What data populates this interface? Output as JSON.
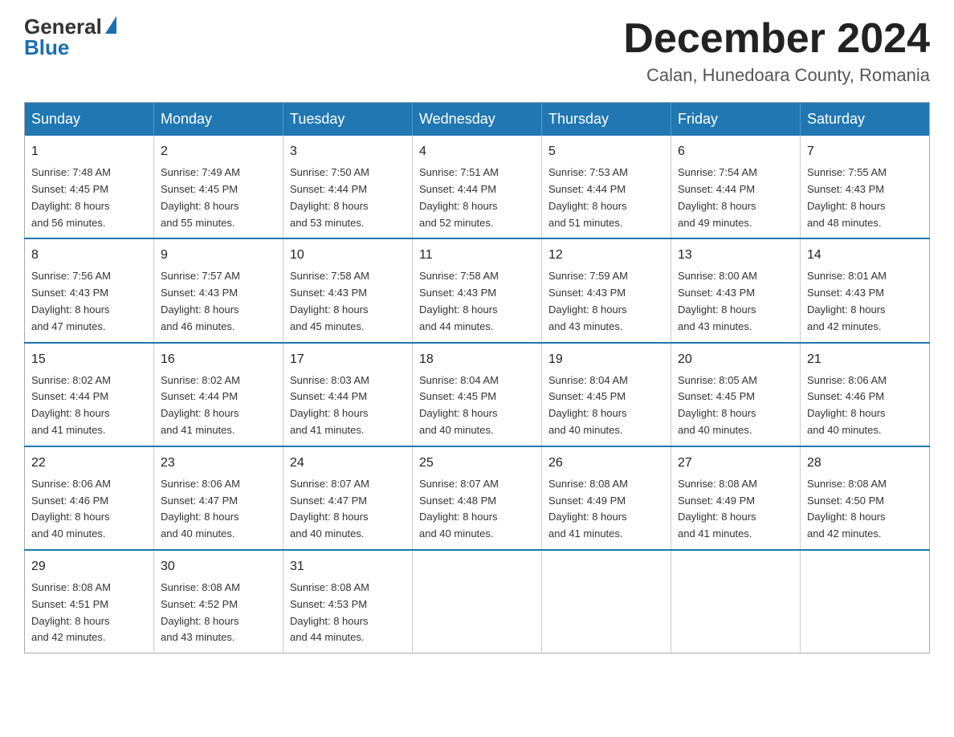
{
  "header": {
    "logo_line1": "General",
    "logo_line2": "Blue",
    "month_title": "December 2024",
    "location": "Calan, Hunedoara County, Romania"
  },
  "weekdays": [
    "Sunday",
    "Monday",
    "Tuesday",
    "Wednesday",
    "Thursday",
    "Friday",
    "Saturday"
  ],
  "weeks": [
    [
      {
        "day": "1",
        "sunrise": "7:48 AM",
        "sunset": "4:45 PM",
        "daylight": "8 hours and 56 minutes."
      },
      {
        "day": "2",
        "sunrise": "7:49 AM",
        "sunset": "4:45 PM",
        "daylight": "8 hours and 55 minutes."
      },
      {
        "day": "3",
        "sunrise": "7:50 AM",
        "sunset": "4:44 PM",
        "daylight": "8 hours and 53 minutes."
      },
      {
        "day": "4",
        "sunrise": "7:51 AM",
        "sunset": "4:44 PM",
        "daylight": "8 hours and 52 minutes."
      },
      {
        "day": "5",
        "sunrise": "7:53 AM",
        "sunset": "4:44 PM",
        "daylight": "8 hours and 51 minutes."
      },
      {
        "day": "6",
        "sunrise": "7:54 AM",
        "sunset": "4:44 PM",
        "daylight": "8 hours and 49 minutes."
      },
      {
        "day": "7",
        "sunrise": "7:55 AM",
        "sunset": "4:43 PM",
        "daylight": "8 hours and 48 minutes."
      }
    ],
    [
      {
        "day": "8",
        "sunrise": "7:56 AM",
        "sunset": "4:43 PM",
        "daylight": "8 hours and 47 minutes."
      },
      {
        "day": "9",
        "sunrise": "7:57 AM",
        "sunset": "4:43 PM",
        "daylight": "8 hours and 46 minutes."
      },
      {
        "day": "10",
        "sunrise": "7:58 AM",
        "sunset": "4:43 PM",
        "daylight": "8 hours and 45 minutes."
      },
      {
        "day": "11",
        "sunrise": "7:58 AM",
        "sunset": "4:43 PM",
        "daylight": "8 hours and 44 minutes."
      },
      {
        "day": "12",
        "sunrise": "7:59 AM",
        "sunset": "4:43 PM",
        "daylight": "8 hours and 43 minutes."
      },
      {
        "day": "13",
        "sunrise": "8:00 AM",
        "sunset": "4:43 PM",
        "daylight": "8 hours and 43 minutes."
      },
      {
        "day": "14",
        "sunrise": "8:01 AM",
        "sunset": "4:43 PM",
        "daylight": "8 hours and 42 minutes."
      }
    ],
    [
      {
        "day": "15",
        "sunrise": "8:02 AM",
        "sunset": "4:44 PM",
        "daylight": "8 hours and 41 minutes."
      },
      {
        "day": "16",
        "sunrise": "8:02 AM",
        "sunset": "4:44 PM",
        "daylight": "8 hours and 41 minutes."
      },
      {
        "day": "17",
        "sunrise": "8:03 AM",
        "sunset": "4:44 PM",
        "daylight": "8 hours and 41 minutes."
      },
      {
        "day": "18",
        "sunrise": "8:04 AM",
        "sunset": "4:45 PM",
        "daylight": "8 hours and 40 minutes."
      },
      {
        "day": "19",
        "sunrise": "8:04 AM",
        "sunset": "4:45 PM",
        "daylight": "8 hours and 40 minutes."
      },
      {
        "day": "20",
        "sunrise": "8:05 AM",
        "sunset": "4:45 PM",
        "daylight": "8 hours and 40 minutes."
      },
      {
        "day": "21",
        "sunrise": "8:06 AM",
        "sunset": "4:46 PM",
        "daylight": "8 hours and 40 minutes."
      }
    ],
    [
      {
        "day": "22",
        "sunrise": "8:06 AM",
        "sunset": "4:46 PM",
        "daylight": "8 hours and 40 minutes."
      },
      {
        "day": "23",
        "sunrise": "8:06 AM",
        "sunset": "4:47 PM",
        "daylight": "8 hours and 40 minutes."
      },
      {
        "day": "24",
        "sunrise": "8:07 AM",
        "sunset": "4:47 PM",
        "daylight": "8 hours and 40 minutes."
      },
      {
        "day": "25",
        "sunrise": "8:07 AM",
        "sunset": "4:48 PM",
        "daylight": "8 hours and 40 minutes."
      },
      {
        "day": "26",
        "sunrise": "8:08 AM",
        "sunset": "4:49 PM",
        "daylight": "8 hours and 41 minutes."
      },
      {
        "day": "27",
        "sunrise": "8:08 AM",
        "sunset": "4:49 PM",
        "daylight": "8 hours and 41 minutes."
      },
      {
        "day": "28",
        "sunrise": "8:08 AM",
        "sunset": "4:50 PM",
        "daylight": "8 hours and 42 minutes."
      }
    ],
    [
      {
        "day": "29",
        "sunrise": "8:08 AM",
        "sunset": "4:51 PM",
        "daylight": "8 hours and 42 minutes."
      },
      {
        "day": "30",
        "sunrise": "8:08 AM",
        "sunset": "4:52 PM",
        "daylight": "8 hours and 43 minutes."
      },
      {
        "day": "31",
        "sunrise": "8:08 AM",
        "sunset": "4:53 PM",
        "daylight": "8 hours and 44 minutes."
      },
      null,
      null,
      null,
      null
    ]
  ],
  "labels": {
    "sunrise": "Sunrise:",
    "sunset": "Sunset:",
    "daylight": "Daylight:"
  }
}
